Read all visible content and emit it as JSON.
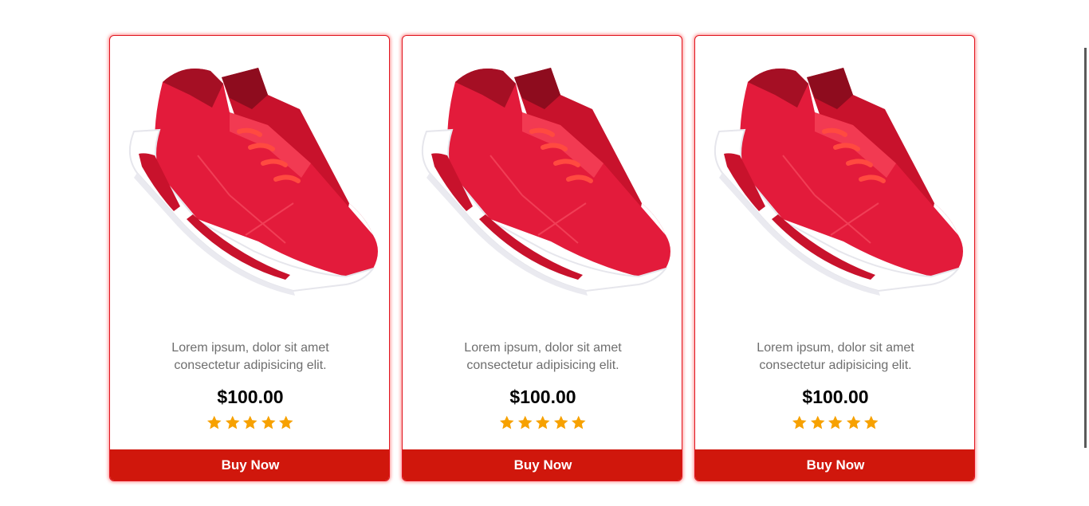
{
  "colors": {
    "accent": "#d0170c",
    "card_border": "#e0141e",
    "star": "#f7a100",
    "shoe_red": "#e31b3b"
  },
  "products": [
    {
      "image_icon": "red-sneakers-icon",
      "desc_line1": "Lorem ipsum, dolor sit amet",
      "desc_line2": "consectetur adipisicing elit.",
      "price": "$100.00",
      "rating": 5,
      "rating_max": 5,
      "button_label": "Buy Now"
    },
    {
      "image_icon": "red-sneakers-icon",
      "desc_line1": "Lorem ipsum, dolor sit amet",
      "desc_line2": "consectetur adipisicing elit.",
      "price": "$100.00",
      "rating": 5,
      "rating_max": 5,
      "button_label": "Buy Now"
    },
    {
      "image_icon": "red-sneakers-icon",
      "desc_line1": "Lorem ipsum, dolor sit amet",
      "desc_line2": "consectetur adipisicing elit.",
      "price": "$100.00",
      "rating": 5,
      "rating_max": 5,
      "button_label": "Buy Now"
    }
  ]
}
